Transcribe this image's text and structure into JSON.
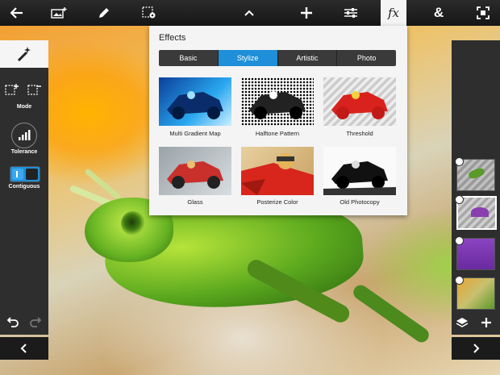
{
  "toolbar": {
    "buttons": [
      {
        "name": "back-arrow-icon",
        "glyph": "←"
      },
      {
        "name": "add-image-icon",
        "glyph": ""
      },
      {
        "name": "pencil-icon",
        "glyph": ""
      },
      {
        "name": "selection-settings-icon",
        "glyph": ""
      },
      {
        "name": "chevron-up-icon",
        "glyph": "⌃"
      },
      {
        "name": "plus-icon",
        "glyph": "+"
      },
      {
        "name": "sliders-icon",
        "glyph": ""
      },
      {
        "name": "fx-icon",
        "glyph": "fx"
      },
      {
        "name": "ampersand-icon",
        "glyph": "&"
      },
      {
        "name": "fit-screen-icon",
        "glyph": ""
      }
    ]
  },
  "left_panel": {
    "mode_label": "Mode",
    "tolerance_label": "Tolerance",
    "contiguous_label": "Contiguous"
  },
  "effects": {
    "title": "Effects",
    "tabs": [
      "Basic",
      "Stylize",
      "Artistic",
      "Photo"
    ],
    "selected_tab": "Stylize",
    "items": [
      {
        "label": "Multi Gradient Map"
      },
      {
        "label": "Halftone Pattern"
      },
      {
        "label": "Threshold"
      },
      {
        "label": "Glass"
      },
      {
        "label": "Posterize Color"
      },
      {
        "label": "Old Photocopy"
      }
    ]
  },
  "colors": {
    "toolbar_bg": "#1c1c1c",
    "accent": "#1e8fd8",
    "panel_bg": "#2e2e2e"
  }
}
